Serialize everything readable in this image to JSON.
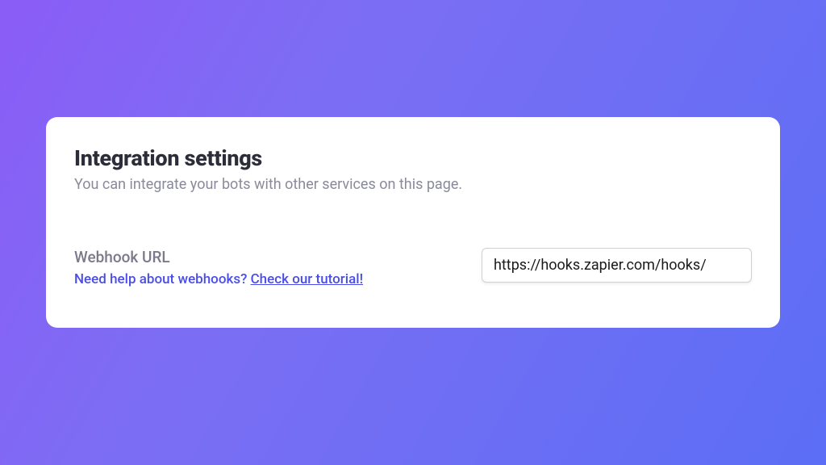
{
  "header": {
    "title": "Integration settings",
    "subtitle": "You can integrate your bots with other services on this page."
  },
  "form": {
    "webhook": {
      "label": "Webhook URL",
      "help_prefix": "Need help about webhooks? ",
      "help_link_text": "Check our tutorial!",
      "value": "https://hooks.zapier.com/hooks/"
    }
  }
}
